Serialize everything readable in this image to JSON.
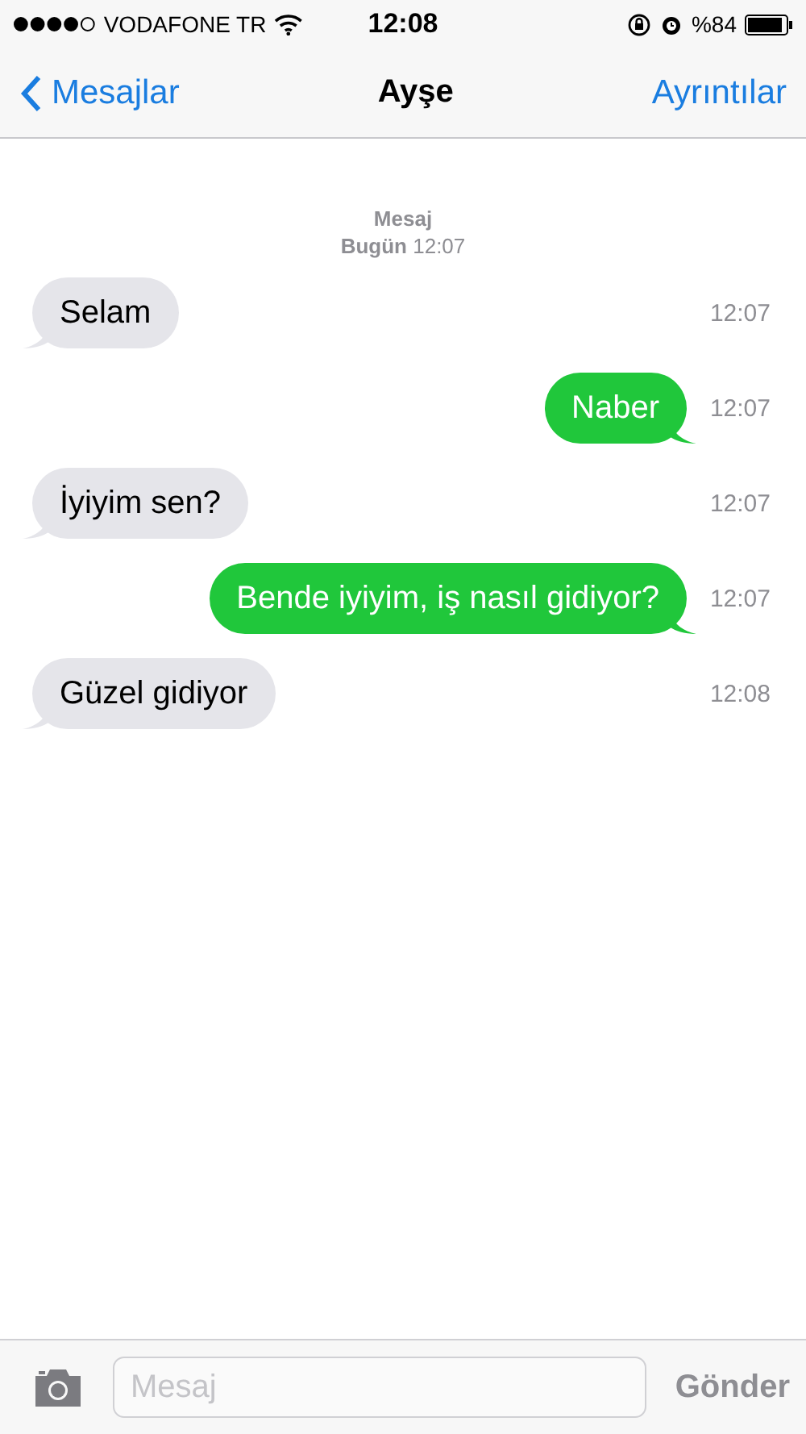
{
  "status_bar": {
    "carrier": "VODAFONE TR",
    "time": "12:08",
    "battery_text": "%84"
  },
  "nav": {
    "back": "Mesajlar",
    "title": "Ayşe",
    "details": "Ayrıntılar"
  },
  "thread_header": {
    "service": "Mesaj",
    "day": "Bugün",
    "time": "12:07"
  },
  "messages": [
    {
      "kind": "incoming",
      "text": "Selam",
      "time": "12:07"
    },
    {
      "kind": "outgoing",
      "text": "Naber",
      "time": "12:07"
    },
    {
      "kind": "incoming",
      "text": "İyiyim sen?",
      "time": "12:07"
    },
    {
      "kind": "outgoing",
      "text": "Bende iyiyim, iş nasıl gidiyor?",
      "time": "12:07"
    },
    {
      "kind": "incoming",
      "text": "Güzel gidiyor",
      "time": "12:08"
    }
  ],
  "composer": {
    "placeholder": "Mesaj",
    "send": "Gönder"
  }
}
